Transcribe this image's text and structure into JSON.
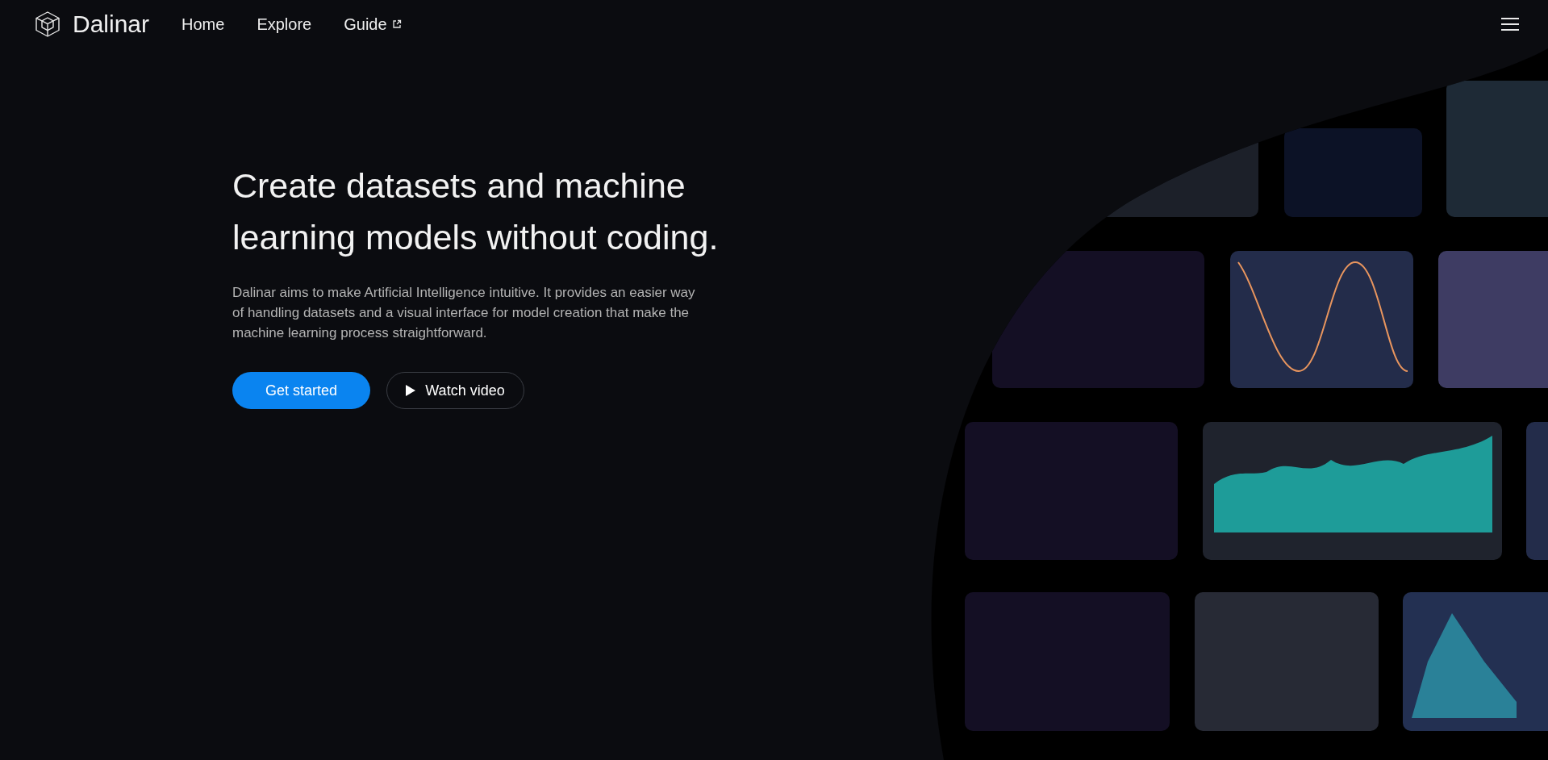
{
  "header": {
    "logo": {
      "name": "Dalinar"
    },
    "nav": [
      {
        "label": "Home",
        "external": false
      },
      {
        "label": "Explore",
        "external": false
      },
      {
        "label": "Guide",
        "external": true
      }
    ]
  },
  "hero": {
    "title_lines": [
      "Create datasets and machine",
      "learning models without coding."
    ],
    "description": "Dalinar aims to make Artificial Intelligence intuitive. It provides an easier way of handling datasets and a visual interface for model creation that make the machine learning process straightforward.",
    "buttons": [
      {
        "label": "Get started",
        "kind": "primary"
      },
      {
        "label": "Watch video",
        "kind": "video"
      }
    ]
  }
}
